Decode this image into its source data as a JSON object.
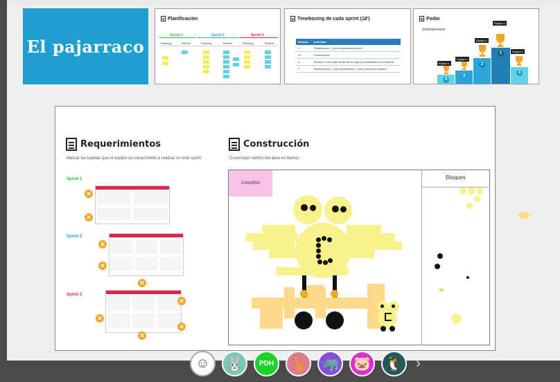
{
  "title_card": {
    "text": "El pajarraco",
    "color": "#1f9fd1"
  },
  "planificacion": {
    "title": "Planificación",
    "sprints": [
      {
        "name": "Sprint 1",
        "color": "#2db84b"
      },
      {
        "name": "Sprint 2",
        "color": "#2aa6d8"
      },
      {
        "name": "Sprint 3",
        "color": "#e0254a"
      }
    ],
    "columns": [
      "Planning",
      "Review",
      "Planning",
      "Review",
      "Planning",
      "Review"
    ]
  },
  "timeboxing": {
    "title": "Timeboxing de cada sprint (18')",
    "headers": [
      "Minutos",
      "Actividad"
    ],
    "rows": [
      [
        "3",
        "Planificación: ¿Qué construimos ahora?"
      ],
      [
        "10",
        "Construcción"
      ],
      [
        "3",
        "Revisión: Listo para la foto de la caja y la validación en la vidriera"
      ],
      [
        "2",
        "Retrospectiva: ¿Qué aprendimos? ¿Qué podemos mejorar?"
      ]
    ]
  },
  "podio": {
    "title": "Podio",
    "subtitle": "¡Felicitaciones!",
    "places": [
      {
        "team": "Equipo x",
        "num": "4"
      },
      {
        "team": "Equipo x",
        "num": "3"
      },
      {
        "team": "Equipo x",
        "num": "2"
      },
      {
        "team": "Equipo x",
        "num": "1"
      },
      {
        "team": "Equipo x",
        "num": "3"
      }
    ]
  },
  "requerimientos": {
    "title": "Requerimientos",
    "subtitle": "Marcar las tarjetas que el equipo se compromete a realizar en este sprint.",
    "sprints": [
      {
        "label": "Sprint 1",
        "color": "#2db84b"
      },
      {
        "label": "Sprint 2",
        "color": "#2aa6d8"
      },
      {
        "label": "Sprint 3",
        "color": "#e0254a"
      }
    ],
    "badge_glyph": "✕"
  },
  "construccion": {
    "title": "Construcción",
    "subtitle": "Construyan dentro del área en blanco.",
    "team_label": "CANARIO",
    "blocks_label": "Bloques"
  },
  "avatars": [
    {
      "icon": "smiley-icon",
      "color": "#ffffff",
      "glyph": "☺"
    },
    {
      "icon": "rabbit-icon",
      "color": "#7cc7b8",
      "glyph": "🐰"
    },
    {
      "icon": "pdh-badge",
      "color": "#1bd32b",
      "glyph": "PDH"
    },
    {
      "icon": "giraffe-icon",
      "color": "#e07b8e",
      "glyph": "🦒"
    },
    {
      "icon": "rhino-icon",
      "color": "#8a4fd6",
      "glyph": "🦏"
    },
    {
      "icon": "pig-icon",
      "color": "#e02bd6",
      "glyph": "🐷"
    },
    {
      "icon": "penguin-icon",
      "color": "#1f5a53",
      "glyph": "🐧"
    }
  ],
  "next_glyph": "›"
}
